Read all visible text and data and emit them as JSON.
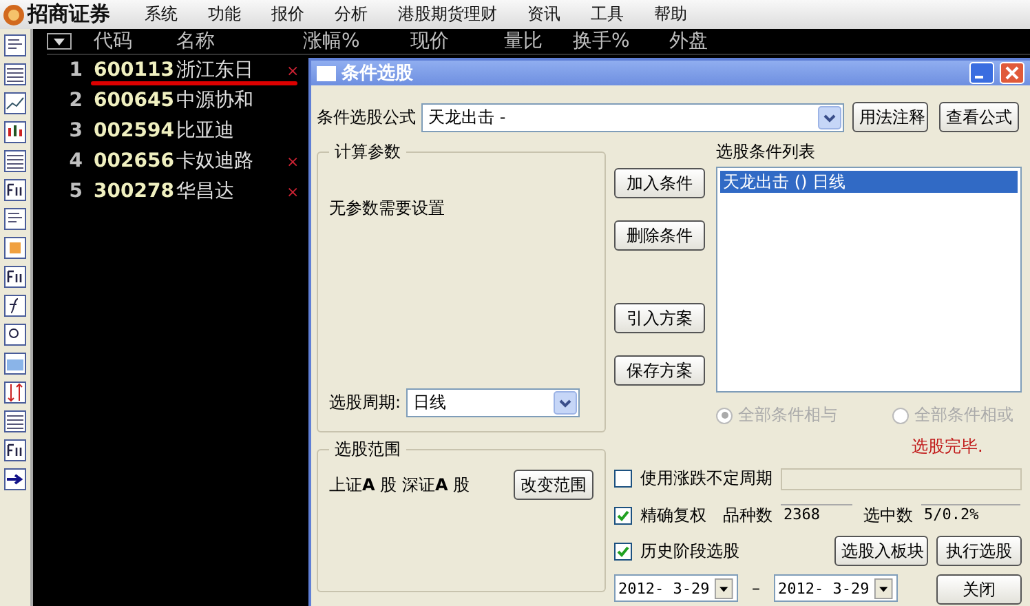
{
  "app": {
    "logo": "招商证券",
    "menu": [
      "系统",
      "功能",
      "报价",
      "分析",
      "港股期货理财",
      "资讯",
      "工具",
      "帮助"
    ]
  },
  "table": {
    "columns": [
      "代码",
      "名称",
      "涨幅%",
      "现价",
      "量比",
      "换手%",
      "外盘"
    ],
    "rows": [
      {
        "index": "1",
        "code": "600113",
        "name": "浙江东日",
        "mark": "×",
        "selected": true
      },
      {
        "index": "2",
        "code": "600645",
        "name": "中源协和",
        "selected": false
      },
      {
        "index": "3",
        "code": "002594",
        "name": "比亚迪",
        "selected": false
      },
      {
        "index": "4",
        "code": "002656",
        "name": "卡奴迪路",
        "mark": "×",
        "selected": false
      },
      {
        "index": "5",
        "code": "300278",
        "name": "华昌达",
        "mark": "×",
        "selected": false
      }
    ]
  },
  "dialog": {
    "title": "条件选股",
    "formula": {
      "label": "条件选股公式",
      "value": "天龙出击 -",
      "buttons": [
        "用法注释",
        "查看公式"
      ]
    },
    "params": {
      "title": "计算参数",
      "text": "无参数需要设置",
      "period_label": "选股周期:",
      "period_value": "日线"
    },
    "range": {
      "title": "选股范围",
      "text": "上证**A** 股  深证**A** 股",
      "button": "改变范围"
    },
    "side_buttons": [
      "加入条件",
      "删除条件",
      "引入方案",
      "保存方案"
    ],
    "conditions": {
      "label": "选股条件列表",
      "items": [
        {
          "text": "天龙出击  ()  日线",
          "selected": true
        }
      ]
    },
    "logic": [
      {
        "label": "全部条件相与",
        "selected": true,
        "disabled": true
      },
      {
        "label": "全部条件相或",
        "selected": false,
        "disabled": true
      }
    ],
    "status": "选股完毕.",
    "variable_period": {
      "label": "使用涨跌不定周期",
      "checked": false
    },
    "exact_adjust": {
      "label": "精确复权",
      "checked": true,
      "count_label": "品种数",
      "count": "2368",
      "picked_label": "选中数",
      "picked": "5/0.2%"
    },
    "history": {
      "label": "历史阶段选股",
      "checked": true,
      "start": "2012- 3-29",
      "separator": "–",
      "end": "2012- 3-29"
    },
    "actions": [
      "选股入板块",
      "执行选股",
      "关闭"
    ]
  }
}
